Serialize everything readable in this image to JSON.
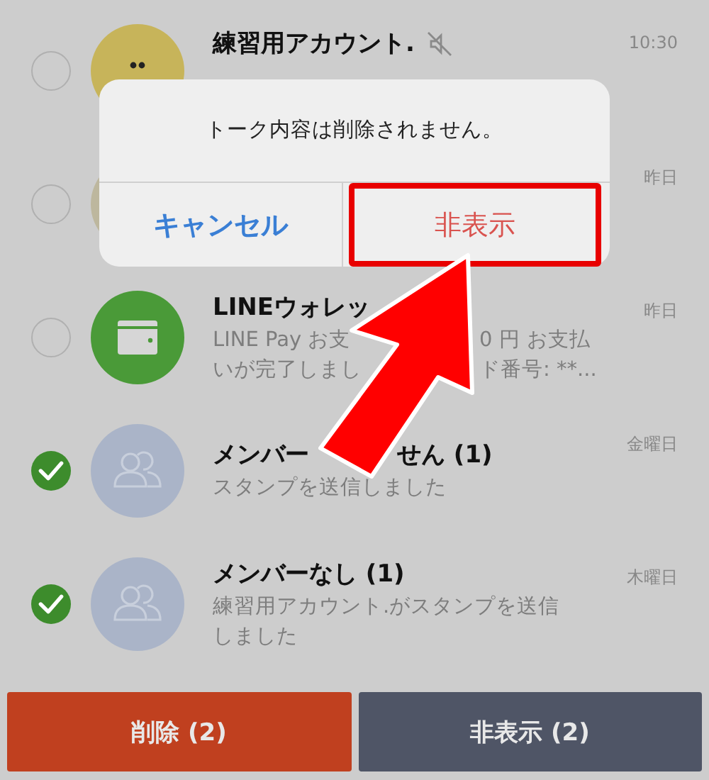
{
  "chats": [
    {
      "kind": "face",
      "selected": false,
      "title": "練習用アカウント.",
      "muted": true,
      "time": "10:30"
    },
    {
      "kind": "picture",
      "selected": false,
      "time": "昨日"
    },
    {
      "kind": "wallet",
      "selected": false,
      "title": [
        "LINEウォレッ"
      ],
      "preview": [
        [
          "LINE Pay お支",
          "0 円 お支払"
        ],
        [
          "いが完了しまし",
          "ド番号: **..."
        ]
      ],
      "time": "昨日"
    },
    {
      "kind": "group",
      "selected": true,
      "title": [
        "メンバー",
        "せん (1)"
      ],
      "preview": [
        [
          "スタンプを送信しました"
        ]
      ],
      "time": "金曜日"
    },
    {
      "kind": "group",
      "selected": true,
      "title": [
        "メンバーなし (1)"
      ],
      "preview": [
        [
          "練習用アカウント.がスタンプを送信"
        ],
        [
          "しました"
        ]
      ],
      "time": "木曜日"
    }
  ],
  "dialog": {
    "message": "トーク内容は削除されません。",
    "buttons": [
      {
        "label": "キャンセル",
        "kind": "cancel",
        "highlighted": false
      },
      {
        "label": "非表示",
        "kind": "destructive",
        "highlighted": true
      }
    ]
  },
  "annotation": {
    "kind": "arrow"
  },
  "actions": [
    {
      "label": "削除 (2)",
      "kind": "delete"
    },
    {
      "label": "非表示 (2)",
      "kind": "hide"
    }
  ]
}
